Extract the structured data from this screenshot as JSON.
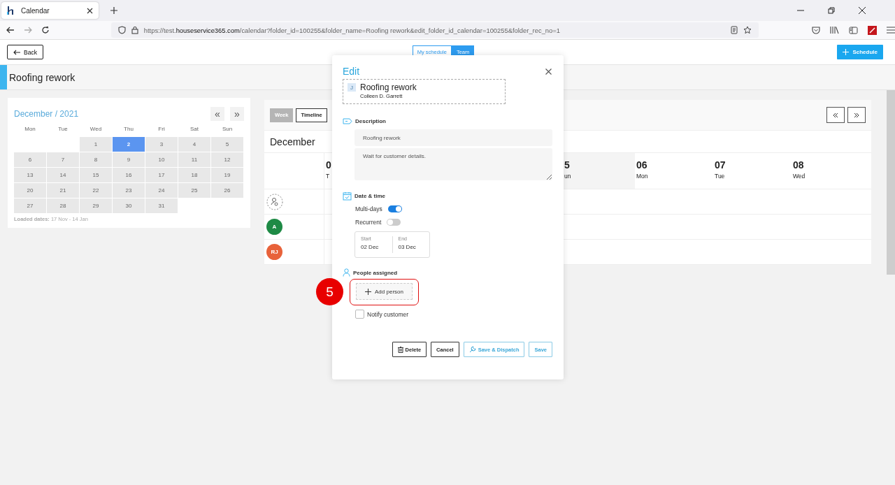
{
  "browser": {
    "tab": {
      "title": "Calendar"
    },
    "url": {
      "scheme": "https://test.",
      "host": "houseservice365.com",
      "path": "/calendar?folder_id=100255&folder_name=Roofing rework&edit_folder_id_calendar=100255&folder_rec_no=1"
    }
  },
  "topbar": {
    "back": "Back",
    "view_toggle": [
      {
        "label": "My schedule",
        "selected": false
      },
      {
        "label": "Team",
        "selected": true
      }
    ],
    "schedule": "Schedule"
  },
  "page_title": "Roofing rework",
  "mini_calendar": {
    "title": "December / 2021",
    "prev": "«",
    "next": "»",
    "weekdays": [
      "Mon",
      "Tue",
      "Wed",
      "Thu",
      "Fri",
      "Sat",
      "Sun"
    ],
    "weeks": [
      [
        {
          "kind": "empty"
        },
        {
          "kind": "empty"
        },
        {
          "kind": "day",
          "day": "1",
          "selected": false
        },
        {
          "kind": "day",
          "day": "2",
          "selected": true
        },
        {
          "kind": "day",
          "day": "3",
          "selected": false
        },
        {
          "kind": "day",
          "day": "4",
          "selected": false
        },
        {
          "kind": "day",
          "day": "5",
          "selected": false
        }
      ],
      [
        {
          "kind": "day",
          "day": "6",
          "selected": false
        },
        {
          "kind": "day",
          "day": "7",
          "selected": false
        },
        {
          "kind": "day",
          "day": "8",
          "selected": false
        },
        {
          "kind": "day",
          "day": "9",
          "selected": false
        },
        {
          "kind": "day",
          "day": "10",
          "selected": false
        },
        {
          "kind": "day",
          "day": "11",
          "selected": false
        },
        {
          "kind": "day",
          "day": "12",
          "selected": false
        }
      ],
      [
        {
          "kind": "day",
          "day": "13",
          "selected": false
        },
        {
          "kind": "day",
          "day": "14",
          "selected": false
        },
        {
          "kind": "day",
          "day": "15",
          "selected": false
        },
        {
          "kind": "day",
          "day": "16",
          "selected": false
        },
        {
          "kind": "day",
          "day": "17",
          "selected": false
        },
        {
          "kind": "day",
          "day": "18",
          "selected": false
        },
        {
          "kind": "day",
          "day": "19",
          "selected": false
        }
      ],
      [
        {
          "kind": "day",
          "day": "20",
          "selected": false
        },
        {
          "kind": "day",
          "day": "21",
          "selected": false
        },
        {
          "kind": "day",
          "day": "22",
          "selected": false
        },
        {
          "kind": "day",
          "day": "23",
          "selected": false
        },
        {
          "kind": "day",
          "day": "24",
          "selected": false
        },
        {
          "kind": "day",
          "day": "25",
          "selected": false
        },
        {
          "kind": "day",
          "day": "26",
          "selected": false
        }
      ],
      [
        {
          "kind": "day",
          "day": "27",
          "selected": false
        },
        {
          "kind": "day",
          "day": "28",
          "selected": false
        },
        {
          "kind": "day",
          "day": "29",
          "selected": false
        },
        {
          "kind": "day",
          "day": "30",
          "selected": false
        },
        {
          "kind": "day",
          "day": "31",
          "selected": false
        },
        {
          "kind": "empty"
        },
        {
          "kind": "empty"
        }
      ]
    ],
    "loaded": "**Loaded dates:** 17 Nov - 14 Jan"
  },
  "timeline": {
    "views": [
      {
        "label": "Week",
        "selected": false
      },
      {
        "label": "Timeline",
        "selected": true
      }
    ],
    "month": "December",
    "leading_day": {
      "number": "0",
      "weekday": "T"
    },
    "days": [
      {
        "number": "5",
        "weekday": "un",
        "weekend": true
      },
      {
        "number": "06",
        "weekday": "Mon",
        "weekend": false
      },
      {
        "number": "07",
        "weekday": "Tue",
        "weekend": false
      },
      {
        "number": "08",
        "weekday": "Wed",
        "weekend": false
      }
    ],
    "people": [
      {
        "kind": "unassigned"
      },
      {
        "kind": "person",
        "initials": "A",
        "color": "#1e8a45"
      },
      {
        "kind": "person",
        "initials": "RJ",
        "color": "#e8623a"
      }
    ]
  },
  "modal": {
    "title": "Edit",
    "job": {
      "badge": "J",
      "title": "Roofing rework",
      "customer": "Colleen D. Garrett"
    },
    "description": {
      "label": "Description",
      "title_value": "Roofing rework",
      "notes_value": "Wait for customer details."
    },
    "date_time": {
      "label": "Date & time",
      "toggles": [
        {
          "label": "Multi-days",
          "on": true
        },
        {
          "label": "Recurrent",
          "on": false
        }
      ],
      "start": {
        "label": "Start",
        "value": "02 Dec"
      },
      "end": {
        "label": "End",
        "value": "03 Dec"
      }
    },
    "people": {
      "label": "People assigned",
      "add_button": "Add person"
    },
    "notify": {
      "label": "Notify customer",
      "checked": false
    },
    "buttons": [
      {
        "label": "Delete",
        "kind": "delete"
      },
      {
        "label": "Cancel",
        "kind": "plain"
      },
      {
        "label": "Save & Dispatch",
        "kind": "dispatch"
      },
      {
        "label": "Save",
        "kind": "primary"
      }
    ]
  },
  "annotation": {
    "step": "5"
  }
}
